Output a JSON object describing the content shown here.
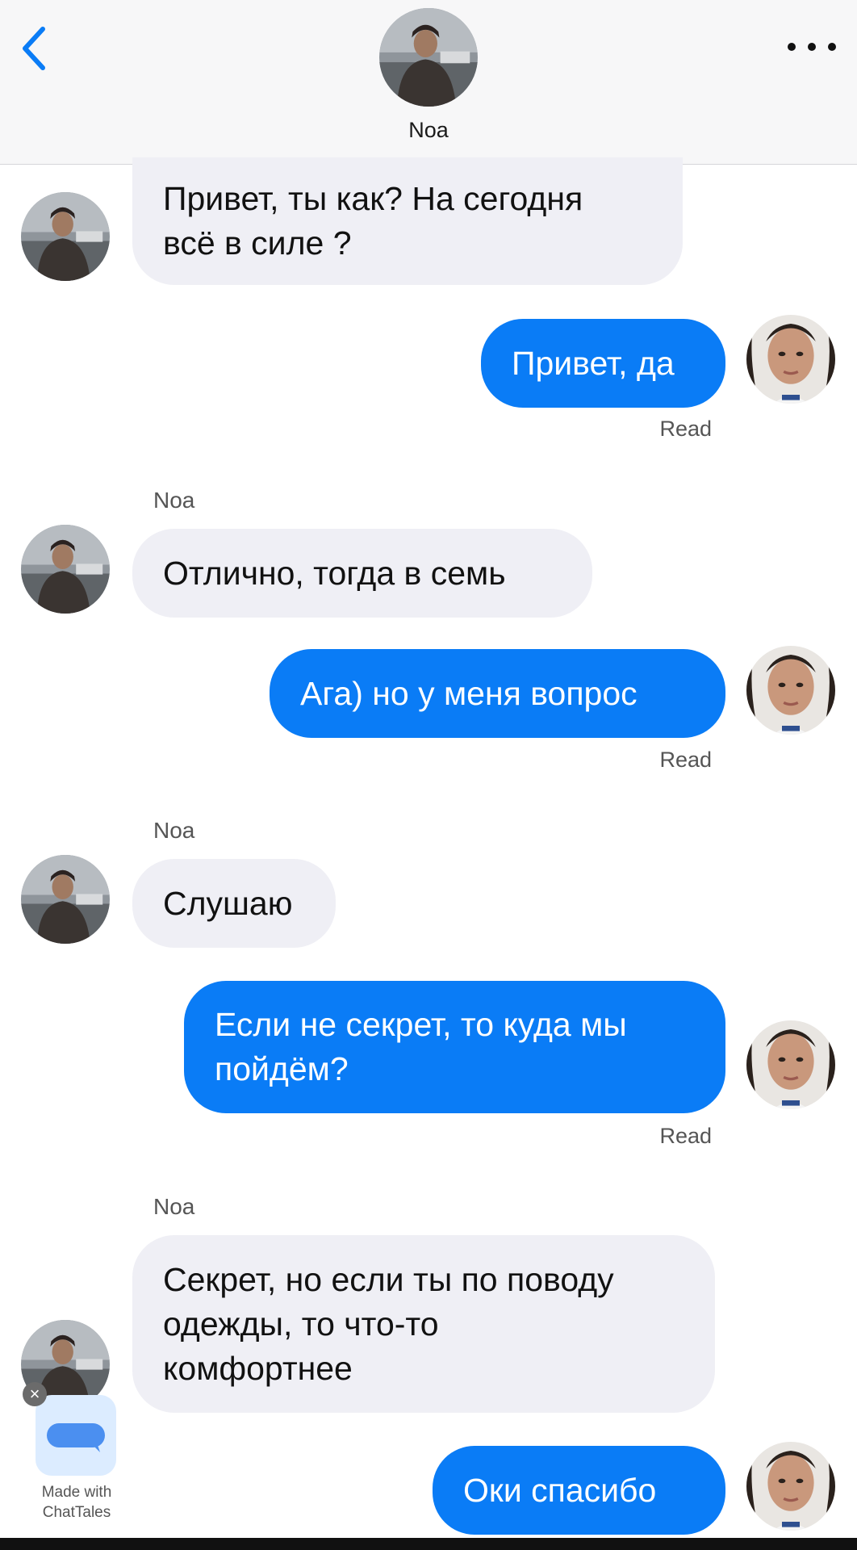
{
  "header": {
    "contact_name": "Noa",
    "back_icon": "chevron-left-icon",
    "more_icon": "more-horizontal-icon",
    "accent_color": "#0a7cf6"
  },
  "messages": [
    {
      "direction": "incoming",
      "lines": [
        "Привет, ты как? На сегодня",
        "всё в силе ?"
      ]
    },
    {
      "direction": "outgoing",
      "text": "Привет, да",
      "status": "Read"
    },
    {
      "direction": "incoming",
      "sender": "Noa",
      "text": "Отлично, тогда в семь"
    },
    {
      "direction": "outgoing",
      "text": "Ага) но у меня вопрос",
      "status": "Read"
    },
    {
      "direction": "incoming",
      "sender": "Noa",
      "text": "Слушаю"
    },
    {
      "direction": "outgoing",
      "lines": [
        "Если не секрет, то куда мы",
        "пойдём?"
      ],
      "status": "Read"
    },
    {
      "direction": "incoming",
      "sender": "Noa",
      "lines": [
        "Секрет, но если ты по поводу",
        "одежды, то что-то",
        "комфортнее"
      ]
    },
    {
      "direction": "outgoing",
      "text": "Оки спасибо"
    }
  ],
  "watermark": {
    "line1": "Made with",
    "line2": "ChatTales",
    "close_icon": "close-icon",
    "logo_icon": "chat-bubble-icon"
  }
}
